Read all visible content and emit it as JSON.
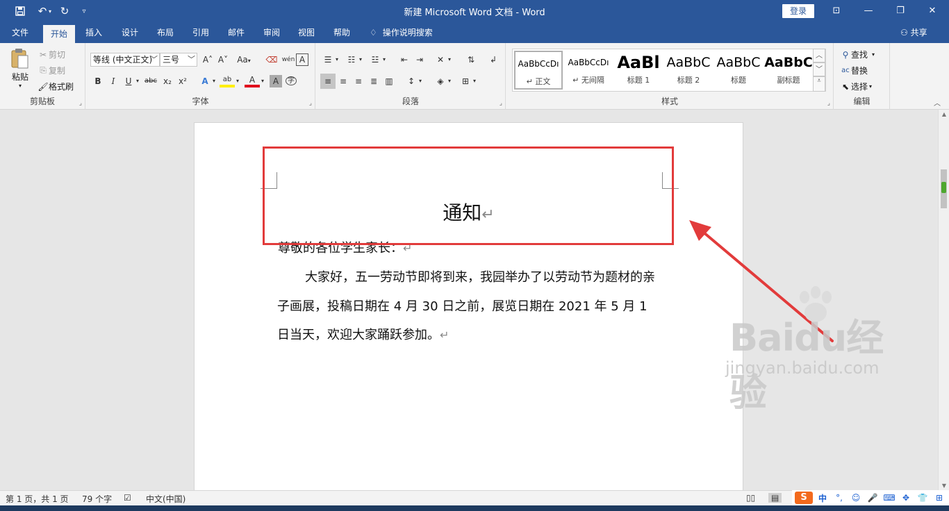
{
  "titlebar": {
    "title": "新建 Microsoft Word 文档  -  Word",
    "login": "登录",
    "save_icon": "save-icon",
    "undo_icon": "undo-icon",
    "redo_icon": "redo-icon",
    "customize_icon": "customize-quick-access-icon"
  },
  "tabs": {
    "items": [
      "文件",
      "开始",
      "插入",
      "设计",
      "布局",
      "引用",
      "邮件",
      "审阅",
      "视图",
      "帮助"
    ],
    "active": "开始",
    "search": "操作说明搜索",
    "share": "共享"
  },
  "clipboard": {
    "paste": "粘贴",
    "cut": "剪切",
    "copy": "复制",
    "format_painter": "格式刷",
    "label": "剪贴板"
  },
  "font": {
    "family": "等线 (中文正文)",
    "size": "三号",
    "label": "字体",
    "bold": "B",
    "italic": "I",
    "underline": "U",
    "strike": "abc",
    "subscript": "x₂",
    "superscript": "x²",
    "grow": "A˄",
    "shrink": "A˅",
    "change_case": "Aa",
    "pinyin": "wén",
    "char_border": "A",
    "text_effect": "A",
    "highlight": "ab",
    "font_color": "A",
    "char_shading": "A",
    "enclose": "字"
  },
  "paragraph": {
    "label": "段落"
  },
  "styles": {
    "label": "样式",
    "items": [
      {
        "preview": "AaBbCcDı",
        "name": "↵ 正文"
      },
      {
        "preview": "AaBbCcDı",
        "name": "↵ 无间隔"
      },
      {
        "preview": "AaBl",
        "name": "标题 1"
      },
      {
        "preview": "AaBbC",
        "name": "标题 2"
      },
      {
        "preview": "AaBbC",
        "name": "标题"
      },
      {
        "preview": "AaBbC",
        "name": "副标题"
      }
    ]
  },
  "editing": {
    "find": "查找",
    "replace": "替换",
    "select": "选择",
    "label": "编辑"
  },
  "document": {
    "title": "通知",
    "return_mark": "↵",
    "salutation": "尊敬的各位学生家长：",
    "body": "大家好，五一劳动节即将到来，我园举办了以劳动节为题材的亲子画展，投稿日期在 4 月 30 日之前，展览日期在 2021 年 5 月 1 日当天，欢迎大家踊跃参加。"
  },
  "annotation": {
    "box_color": "#e23b3b",
    "arrow_color": "#e23b3b"
  },
  "watermark": {
    "brand": "Baidu经验",
    "url": "jingyan.baidu.com"
  },
  "statusbar": {
    "page": "第 1 页，共 1 页",
    "words": "79 个字",
    "language": "中文(中国)"
  },
  "ime": {
    "logo": "S",
    "mode": "中"
  }
}
